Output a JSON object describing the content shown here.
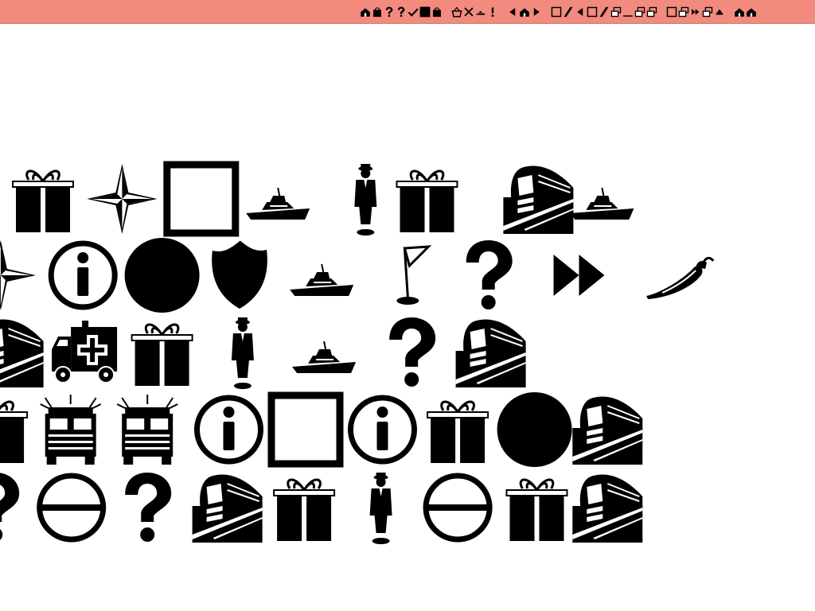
{
  "colors": {
    "topbar": "#f28a7e",
    "ink": "#000000",
    "background": "#ffffff"
  },
  "topbar": {
    "icons": [
      "house-icon",
      "bag-icon",
      "question-icon",
      "question-icon",
      "check-icon",
      "black-square-icon",
      "bag-icon",
      "gap",
      "basket-icon",
      "close-icon",
      "boat-icon",
      "pin-icon",
      "gap",
      "arrow-left-icon",
      "house-icon",
      "arrow-right-icon",
      "gap",
      "square-icon",
      "slash-icon",
      "arrow-left-icon",
      "square-icon",
      "slash-icon",
      "windows-icon",
      "underscore-icon",
      "windows-icon",
      "windows-icon",
      "gap",
      "square-icon",
      "windows-icon",
      "fast-forward-icon",
      "windows-icon",
      "triangle-up-icon",
      "gap",
      "house-icon",
      "house-icon"
    ]
  },
  "grid": {
    "rows": [
      [
        "gift-icon",
        "compass-star-icon",
        "square-frame-icon",
        "boat-icon",
        "man-icon",
        "gift-icon",
        "train-icon",
        "boat-icon"
      ],
      [
        "compass-star-icon",
        "info-icon",
        "circle-icon",
        "shield-icon",
        "boat-icon",
        "golf-flag-icon",
        "question-icon",
        "fast-forward-icon",
        "pepper-icon"
      ],
      [
        "train-icon",
        "ambulance-icon",
        "gift-icon",
        "man-icon",
        "boat-icon",
        "question-icon",
        "train-icon"
      ],
      [
        "gift-icon",
        "fire-truck-icon",
        "fire-truck-icon",
        "info-icon",
        "square-frame-icon",
        "info-icon",
        "gift-icon",
        "circle-icon",
        "train-icon"
      ],
      [
        "question-icon",
        "no-entry-icon",
        "question-icon",
        "train-icon",
        "gift-icon",
        "man-icon",
        "no-entry-icon",
        "gift-icon",
        "train-icon"
      ]
    ]
  }
}
